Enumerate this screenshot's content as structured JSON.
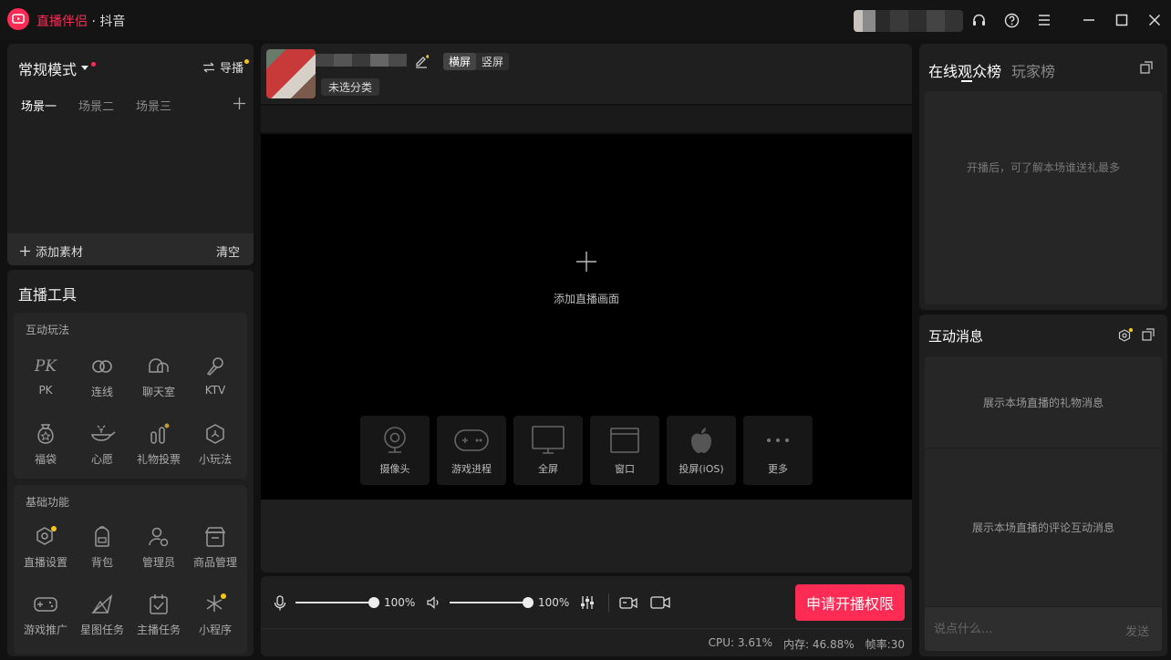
{
  "app": {
    "brand": "直播伴侣",
    "separator": "·",
    "platform": "抖音"
  },
  "mode": {
    "label": "常规模式",
    "guide_label": "导播"
  },
  "scenes": {
    "tabs": [
      "场景一",
      "场景二",
      "场景三"
    ],
    "add_material": "添加素材",
    "clear": "清空"
  },
  "tools": {
    "title": "直播工具",
    "interactive": {
      "title": "互动玩法",
      "items": [
        "PK",
        "连线",
        "聊天室",
        "KTV",
        "福袋",
        "心愿",
        "礼物投票",
        "小玩法"
      ]
    },
    "basic": {
      "title": "基础功能",
      "items": [
        "直播设置",
        "背包",
        "管理员",
        "商品管理",
        "游戏推广",
        "星图任务",
        "主播任务",
        "小程序"
      ]
    }
  },
  "stream": {
    "orientation_landscape": "横屏",
    "orientation_portrait": "竖屏",
    "category": "未选分类"
  },
  "preview": {
    "add_label": "添加直播画面",
    "sources": [
      "摄像头",
      "游戏进程",
      "全屏",
      "窗口",
      "投屏(iOS)",
      "更多"
    ]
  },
  "controls": {
    "mic_volume": "100%",
    "speaker_volume": "100%",
    "mic_level": 1.0,
    "speaker_level": 1.0,
    "apply_button": "申请开播权限"
  },
  "status": {
    "cpu": "CPU: 3.61%",
    "memory": "内存: 46.88%",
    "fps": "帧率:30"
  },
  "rank": {
    "tab_online": "在线观众榜",
    "tab_player": "玩家榜",
    "empty_text": "开播后，可了解本场谁送礼最多"
  },
  "messages": {
    "title": "互动消息",
    "gift_placeholder": "展示本场直播的礼物消息",
    "comment_placeholder": "展示本场直播的评论互动消息",
    "input_placeholder": "说点什么...",
    "send_label": "发送"
  },
  "colors": {
    "accent": "#fe2c55",
    "notify_dot": "#f5c518"
  }
}
